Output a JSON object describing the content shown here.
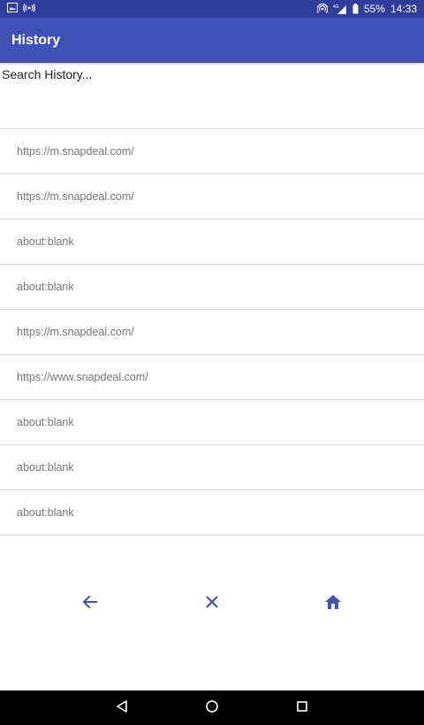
{
  "status_bar": {
    "battery": "55%",
    "time": "14:33",
    "network": "4G"
  },
  "app_bar": {
    "title": "History"
  },
  "search": {
    "placeholder": "Search History..."
  },
  "history": [
    {
      "url": "https://m.snapdeal.com/"
    },
    {
      "url": "https://m.snapdeal.com/"
    },
    {
      "url": "about:blank"
    },
    {
      "url": "about:blank"
    },
    {
      "url": "https://m.snapdeal.com/"
    },
    {
      "url": "https://www.snapdeal.com/"
    },
    {
      "url": "about:blank"
    },
    {
      "url": "about:blank"
    },
    {
      "url": "about:blank"
    }
  ],
  "toolbar": {
    "icons": [
      "back-arrow-icon",
      "close-icon",
      "home-icon"
    ],
    "accent": "#3f51b5"
  },
  "colors": {
    "status_bar": "#2f3d9c",
    "app_bar": "#3f51b5",
    "divider": "#d9d9d9",
    "row_text": "#777777"
  }
}
